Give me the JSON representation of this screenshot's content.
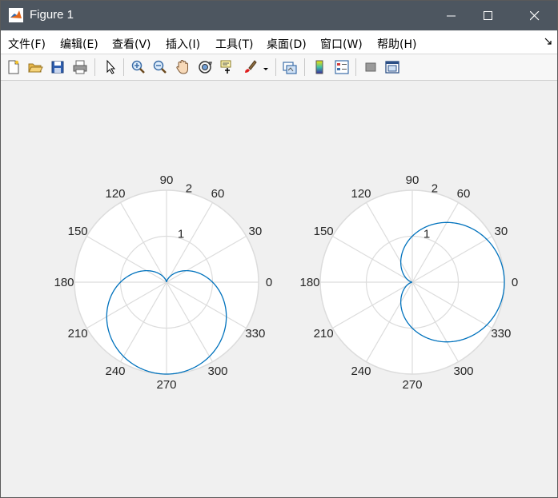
{
  "window": {
    "title": "Figure 1",
    "controls": {
      "minimize": "minimize",
      "maximize": "maximize",
      "close": "close"
    }
  },
  "menu": [
    {
      "label": "文件(F)"
    },
    {
      "label": "编辑(E)"
    },
    {
      "label": "查看(V)"
    },
    {
      "label": "插入(I)"
    },
    {
      "label": "工具(T)"
    },
    {
      "label": "桌面(D)"
    },
    {
      "label": "窗口(W)"
    },
    {
      "label": "帮助(H)"
    }
  ],
  "toolbar": {
    "icons": [
      "new-figure-icon",
      "open-file-icon",
      "save-icon",
      "print-icon",
      "select-arrow-icon",
      "zoom-in-icon",
      "zoom-out-icon",
      "pan-hand-icon",
      "rotate-3d-icon",
      "data-cursor-icon",
      "brush-icon",
      "brush-dropdown-icon",
      "link-plot-icon",
      "colorbar-icon",
      "legend-icon",
      "hide-plot-tools-icon",
      "show-plot-tools-icon"
    ]
  },
  "colors": {
    "line": "#0072bd",
    "grid": "#dcdcdc",
    "axes_bg": "#ffffff"
  },
  "chart_data": [
    {
      "type": "line",
      "coordinate_system": "polar",
      "title": "",
      "angle_ticks": [
        "0",
        "30",
        "60",
        "90",
        "120",
        "150",
        "180",
        "210",
        "240",
        "270",
        "300",
        "330"
      ],
      "r_ticks": [
        "1",
        "2"
      ],
      "rlim": [
        0,
        2
      ],
      "grid": true,
      "series": [
        {
          "equation": "r = 1 - sin(theta)",
          "theta_range_deg": [
            0,
            360
          ],
          "r_max": 2
        }
      ]
    },
    {
      "type": "line",
      "coordinate_system": "polar",
      "title": "",
      "angle_ticks": [
        "0",
        "30",
        "60",
        "90",
        "120",
        "150",
        "180",
        "210",
        "240",
        "270",
        "300",
        "330"
      ],
      "r_ticks": [
        "1",
        "2"
      ],
      "rlim": [
        0,
        2
      ],
      "grid": true,
      "series": [
        {
          "equation": "r = 1 + cos(theta)",
          "theta_range_deg": [
            0,
            360
          ],
          "r_max": 2
        }
      ]
    }
  ]
}
